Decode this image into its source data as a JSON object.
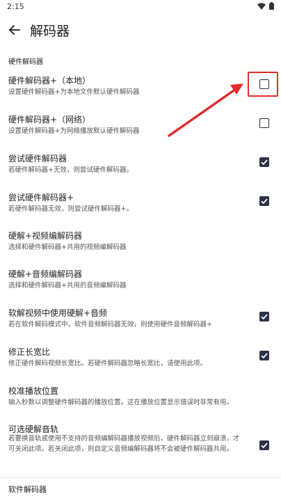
{
  "status": {
    "time": "2:15"
  },
  "header": {
    "title": "解码器"
  },
  "section1": "硬件解码器",
  "section2": "软件解码器",
  "items": [
    {
      "title": "硬件解码器+（本地）",
      "summary": "设置硬件解码器+为本地文件默认硬件解码器",
      "checked": false
    },
    {
      "title": "硬件解码器+（网络）",
      "summary": "设置硬件解码器+为网络播放默认硬件解码器",
      "checked": false
    },
    {
      "title": "尝试硬件解码器",
      "summary": "若硬件解码器+无效，则尝试硬件解码器。",
      "checked": true
    },
    {
      "title": "尝试硬件解码器+",
      "summary": "若硬件解码器无效，则尝试硬件解码器+。",
      "checked": true
    },
    {
      "title": "硬解+视频编解码器",
      "summary": "选择和硬件解码器+共用的视频编解码器"
    },
    {
      "title": "硬解+音频编解码器",
      "summary": "选择和硬件解码器+共用的音频编解码器"
    },
    {
      "title": "软解视频中使用硬解+音频",
      "summary": "若在软件解码模式中，软件音频解码器无效，则使用硬件音频解码器+",
      "checked": true
    },
    {
      "title": "修正长宽比",
      "summary": "修正硬件解码视频长宽比。若硬件解码器忽略长宽比，请使用此项。",
      "checked": true
    },
    {
      "title": "校准播放位置",
      "summary": "输入秒数以调整硬件解码器的播放位置。这在播放位置显示错误时非常有用。"
    },
    {
      "title": "可选硬解音轨",
      "summary": "若要换音轨或使用不支持的音频编解码器播放视频后，硬件解码器立刻崩溃，才可关闭此项。若关闭此项，则自定义音频编解码器将不会被硬件解码器共用。",
      "checked": true
    }
  ],
  "colors": {
    "accent": "#2e3246",
    "highlight": "#e02d2d"
  }
}
